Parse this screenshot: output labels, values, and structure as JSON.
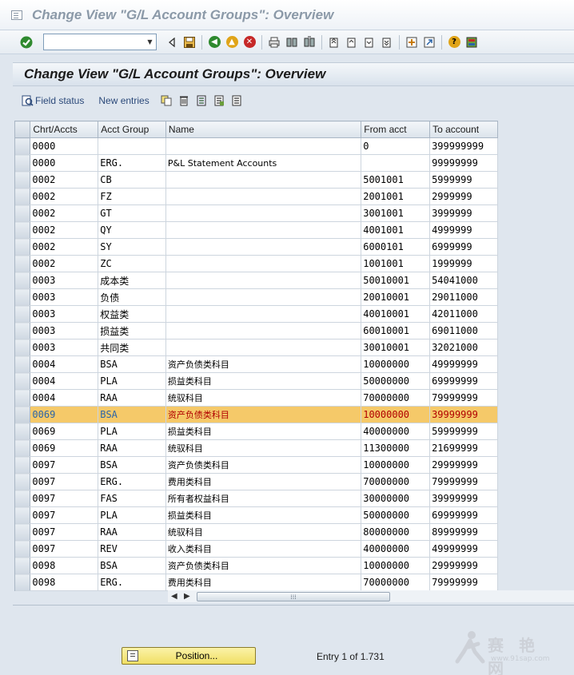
{
  "window": {
    "title": "Change View \"G/L Account Groups\": Overview"
  },
  "toolbar": {
    "icons": [
      "enter-icon",
      "command-field",
      "back-triangle-icon",
      "save-icon",
      "back-icon",
      "exit-icon",
      "cancel-icon",
      "print-icon",
      "find-icon",
      "find-next-icon",
      "first-page-icon",
      "previous-page-icon",
      "next-page-icon",
      "last-page-icon",
      "create-session-icon",
      "shortcut-icon",
      "help-icon",
      "layout-icon"
    ],
    "command_value": ""
  },
  "screen": {
    "title": "Change View \"G/L Account Groups\": Overview"
  },
  "app_toolbar": {
    "field_status": "Field status",
    "new_entries": "New entries"
  },
  "table": {
    "columns": [
      "Chrt/Accts",
      "Acct Group",
      "Name",
      "From acct",
      "To account"
    ],
    "rows": [
      [
        "0000",
        "",
        "",
        "0",
        "399999999"
      ],
      [
        "0000",
        "ERG.",
        "P&L Statement Accounts",
        "",
        "99999999"
      ],
      [
        "0002",
        "CB",
        "",
        "5001001",
        "5999999"
      ],
      [
        "0002",
        "FZ",
        "",
        "2001001",
        "2999999"
      ],
      [
        "0002",
        "GT",
        "",
        "3001001",
        "3999999"
      ],
      [
        "0002",
        "QY",
        "",
        "4001001",
        "4999999"
      ],
      [
        "0002",
        "SY",
        "",
        "6000101",
        "6999999"
      ],
      [
        "0002",
        "ZC",
        "",
        "1001001",
        "1999999"
      ],
      [
        "0003",
        "成本类",
        "",
        "50010001",
        "54041000"
      ],
      [
        "0003",
        "负债",
        "",
        "20010001",
        "29011000"
      ],
      [
        "0003",
        "权益类",
        "",
        "40010001",
        "42011000"
      ],
      [
        "0003",
        "损益类",
        "",
        "60010001",
        "69011000"
      ],
      [
        "0003",
        "共同类",
        "",
        "30010001",
        "32021000"
      ],
      [
        "0004",
        "BSA",
        "资产负债类科目",
        "10000000",
        "49999999"
      ],
      [
        "0004",
        "PLA",
        "损益类科目",
        "50000000",
        "69999999"
      ],
      [
        "0004",
        "RAA",
        "统驭科目",
        "70000000",
        "79999999"
      ],
      [
        "0069",
        "BSA",
        "资产负债类科目",
        "10000000",
        "39999999"
      ],
      [
        "0069",
        "PLA",
        "损益类科目",
        "40000000",
        "59999999"
      ],
      [
        "0069",
        "RAA",
        "统驭科目",
        "11300000",
        "21699999"
      ],
      [
        "0097",
        "BSA",
        "资产负债类科目",
        "10000000",
        "29999999"
      ],
      [
        "0097",
        "ERG.",
        "费用类科目",
        "70000000",
        "79999999"
      ],
      [
        "0097",
        "FAS",
        "所有者权益科目",
        "30000000",
        "39999999"
      ],
      [
        "0097",
        "PLA",
        "损益类科目",
        "50000000",
        "69999999"
      ],
      [
        "0097",
        "RAA",
        "统驭科目",
        "80000000",
        "89999999"
      ],
      [
        "0097",
        "REV",
        "收入类科目",
        "40000000",
        "49999999"
      ],
      [
        "0098",
        "BSA",
        "资产负债类科目",
        "10000000",
        "29999999"
      ],
      [
        "0098",
        "ERG.",
        "费用类科目",
        "70000000",
        "79999999"
      ]
    ],
    "highlighted_row": 16
  },
  "footer": {
    "position_button": "Position...",
    "entry_label": "Entry",
    "entry_current": "1",
    "entry_of": "of",
    "entry_total": "1.731"
  },
  "watermark": {
    "text": "赛 艳 网",
    "url": "www.91sap.com"
  },
  "colors": {
    "highlight": "#f5c969",
    "position_button": "#f0de64",
    "link_blue": "#2a64a8",
    "value_red": "#b10000"
  }
}
